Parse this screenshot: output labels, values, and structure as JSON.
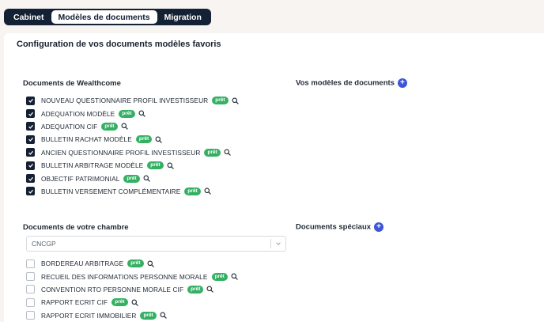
{
  "tabs": [
    {
      "label": "Cabinet"
    },
    {
      "label": "Modèles de documents"
    },
    {
      "label": "Migration"
    }
  ],
  "page_title": "Configuration de vos documents modèles favoris",
  "wealthcome": {
    "title": "Documents de Wealthcome",
    "items": [
      {
        "label": "NOUVEAU QUESTIONNAIRE PROFIL INVESTISSEUR",
        "badge": "prêt",
        "checked": true
      },
      {
        "label": "ADEQUATION MODÈLE",
        "badge": "prêt",
        "checked": true
      },
      {
        "label": "ADEQUATION CIF",
        "badge": "prêt",
        "checked": true
      },
      {
        "label": "BULLETIN RACHAT MODÈLE",
        "badge": "prêt",
        "checked": true
      },
      {
        "label": "ANCIEN QUESTIONNAIRE PROFIL INVESTISSEUR",
        "badge": "prêt",
        "checked": true
      },
      {
        "label": "BULLETIN ARBITRAGE MODÈLE",
        "badge": "prêt",
        "checked": true
      },
      {
        "label": "OBJECTIF PATRIMONIAL",
        "badge": "prêt",
        "checked": true
      },
      {
        "label": "BULLETIN VERSEMENT COMPLÉMENTAIRE",
        "badge": "prêt",
        "checked": true
      }
    ]
  },
  "vos_modeles": {
    "title": "Vos modèles de documents"
  },
  "chambre": {
    "title": "Documents de votre chambre",
    "select_value": "CNCGP",
    "items": [
      {
        "label": "BORDEREAU ARBITRAGE",
        "badge": "prêt",
        "checked": false
      },
      {
        "label": "RECUEIL DES INFORMATIONS PERSONNE MORALE",
        "badge": "prêt",
        "checked": false
      },
      {
        "label": "CONVENTION RTO PERSONNE MORALE CIF",
        "badge": "prêt",
        "checked": false
      },
      {
        "label": "RAPPORT ECRIT CIF",
        "badge": "prêt",
        "checked": false
      },
      {
        "label": "RAPPORT ECRIT IMMOBILIER",
        "badge": "prêt",
        "checked": false
      }
    ]
  },
  "speciaux": {
    "title": "Documents spéciaux"
  },
  "icons": {
    "add": "plus-circle-icon",
    "view": "magnifier-icon",
    "check": "check-icon",
    "dropdown": "chevron-down-icon"
  },
  "colors": {
    "navy": "#142033",
    "accent": "#3d55d6",
    "ready": "#35b063"
  }
}
